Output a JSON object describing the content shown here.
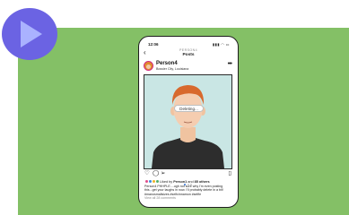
{
  "phone": {
    "status_time": "12:06",
    "status_icons": "▮▮▮ ◠ ▭",
    "nav_subtitle": "PERSON4",
    "nav_title": "Posts",
    "back_icon": "arrow-left-icon",
    "more_icon": "more-horizontal-icon"
  },
  "post": {
    "username": "Person4",
    "location": "Bossier City, Louisiana",
    "overlay_label": "Deleting...",
    "likes_prefix": "Liked by",
    "likes_user": "Person1",
    "likes_connector": "and",
    "likes_count": "85 others",
    "caption_lines": [
      "Person4 PHHPLE....ugh not sure why I'm even posting",
      "this...get your laughs in now. I'll probably delete in a bit!",
      "#manosmallsizes #selfcinnamon #selfie"
    ],
    "comments_link": "View all 28 comments"
  },
  "colors": {
    "background_green": "#84c066",
    "badge_purple": "#6b63e3",
    "accent_story": "#d22a7e"
  }
}
